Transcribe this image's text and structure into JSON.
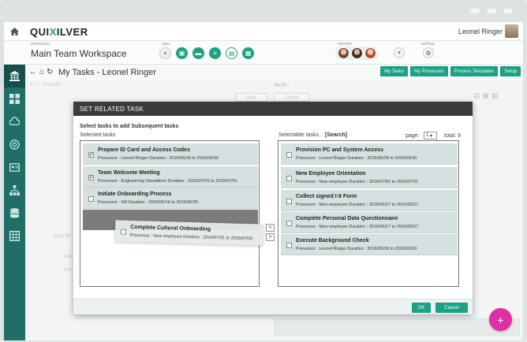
{
  "header": {
    "logo_prefix": "QUI",
    "logo_x": "X",
    "logo_suffix": "ILVER",
    "user_name": "Leonel Ringer"
  },
  "workspace": {
    "caption": "workspace",
    "title": "Main Team Workspace",
    "apps_caption": "apps",
    "member_caption": "member",
    "settings_caption": "settings"
  },
  "page": {
    "title": "My Tasks - Leonel Ringer",
    "tabs": [
      "My Tasks",
      "My Processes",
      "Process Templates",
      "Setup"
    ]
  },
  "background": {
    "counter": "1 / 1 - 3 results",
    "next": "Next ›",
    "save": "Save",
    "cancel": "Cancel",
    "start_label": "Start Re",
    "sub_label": "Sub",
    "visi_label": "Visi"
  },
  "modal": {
    "title": "SET RELATED TASK",
    "instruction": "Select tasks to add Subsequent tasks",
    "selected_label": "Selected tasks",
    "selectable_label": "Selectable tasks",
    "search_label": "[Search]",
    "page_label": "page:",
    "page_value": "1",
    "total_label": "total: 9",
    "ok": "OK",
    "cancel": "Cancel",
    "move_left": "<",
    "move_right": ">",
    "selected_tasks": [
      {
        "name": "Prepare ID Card and Access Codes",
        "meta": "Processor : Leonel Ringer    Duration : 2016/06/28 to 2016/06/30",
        "checked": "✔"
      },
      {
        "name": "Team Welcome Meeting",
        "meta": "Processor : Engineering Operations    Duration : 2016/07/01 to 2016/07/01",
        "checked": "✔"
      },
      {
        "name": "Initiate Onboarding Process",
        "meta": "Processor : HR    Duration : 2016/06/16 to 2016/06/26",
        "checked": ""
      }
    ],
    "selectable_tasks": [
      {
        "name": "Provision PC and System Access",
        "meta": "Processor : Leonel Ringer    Duration : 2016/06/28 to 2016/06/30"
      },
      {
        "name": "New Employee Orientation",
        "meta": "Processor : New employee    Duration : 2016/07/01 to 2016/07/01"
      },
      {
        "name": "Collect signed I-9 Form",
        "meta": "Processor : New employee    Duration : 2016/06/27 to 2016/06/27"
      },
      {
        "name": "Complete Personal Data Questionnaire",
        "meta": "Processor : New employee    Duration : 2016/06/17 to 2016/06/27"
      },
      {
        "name": "Execute Background Check",
        "meta": "Processor : Leonel Ringer    Duration : 2016/06/28 to 2016/06/29"
      }
    ],
    "dragged_task": {
      "name": "Complete Cultural Onboarding",
      "meta": "Processor : New employee    Duration : 2016/07/01 to 2016/07/03"
    }
  },
  "fab_label": "+"
}
